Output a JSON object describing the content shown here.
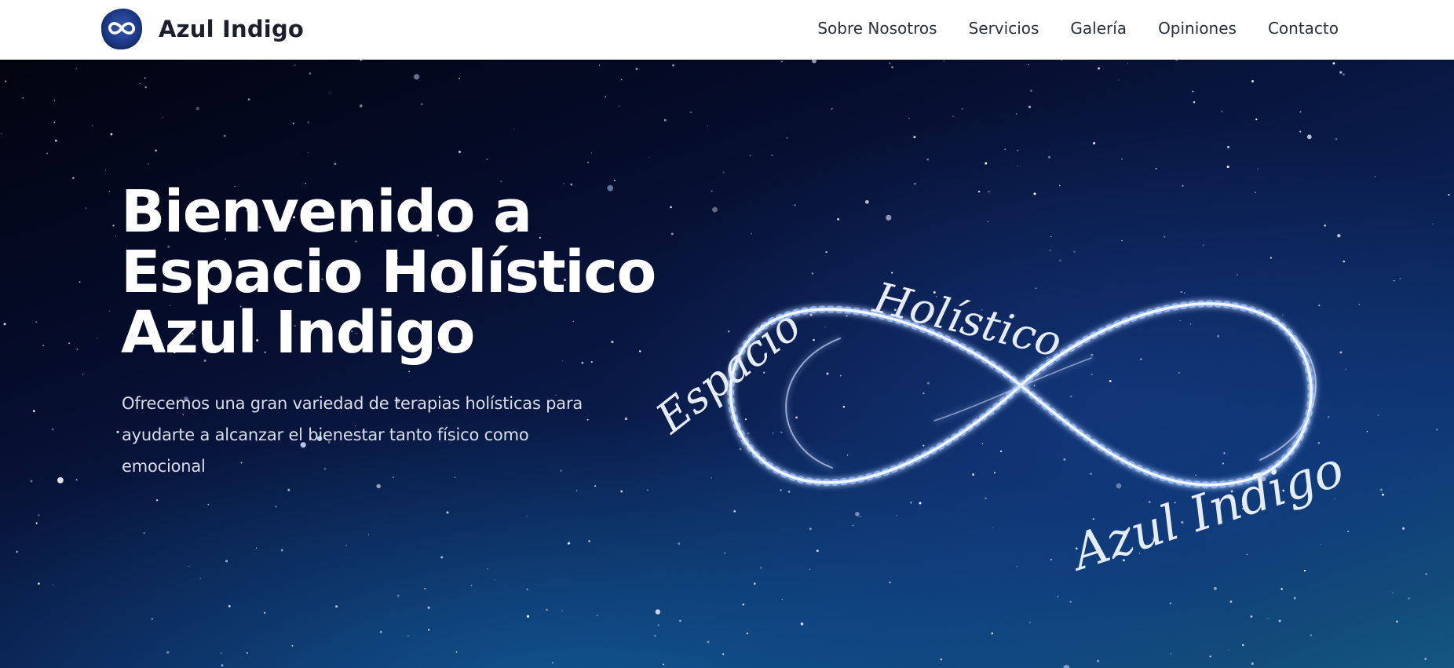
{
  "header": {
    "brand_name": "Azul Indigo",
    "logo_icon": "infinity-icon",
    "nav": [
      {
        "label": "Sobre Nosotros"
      },
      {
        "label": "Servicios"
      },
      {
        "label": "Galería"
      },
      {
        "label": "Opiniones"
      },
      {
        "label": "Contacto"
      }
    ]
  },
  "hero": {
    "title_lines": [
      "Bienvenido a",
      "Espacio Holístico",
      "Azul Indigo"
    ],
    "subtitle_lines": [
      "Ofrecemos una gran variedad de terapias holísticas para",
      "ayudarte a alcanzar el bienestar tanto físico como",
      "emocional"
    ],
    "emblem": {
      "word_1": "Espacio",
      "word_2": "Holístico",
      "word_3": "Azul Indigo"
    }
  },
  "colors": {
    "header_bg": "#ffffff",
    "brand_text": "#1b1f2a",
    "hero_text": "#ffffff",
    "logo_blue": "#1d3b8a"
  }
}
